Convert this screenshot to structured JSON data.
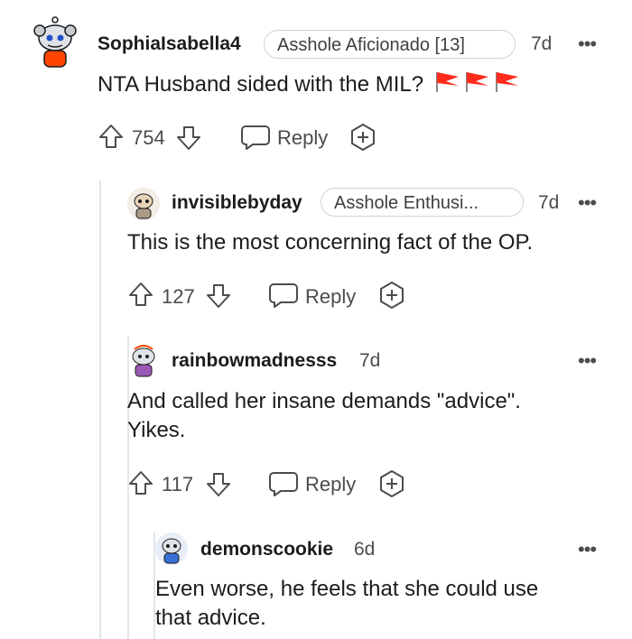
{
  "comments": [
    {
      "username": "SophiaIsabella4",
      "flair": "Asshole Aficionado [13]",
      "time": "7d",
      "body": "NTA Husband sided with the MIL?",
      "flag_emoji": "🚩🚩🚩",
      "votes": "754",
      "reply_label": "Reply",
      "more_label": "•••"
    },
    {
      "username": "invisiblebyday",
      "flair": "Asshole Enthusi...",
      "time": "7d",
      "body": "This is the most concerning fact of the OP.",
      "votes": "127",
      "reply_label": "Reply",
      "more_label": "•••"
    },
    {
      "username": "rainbowmadnesss",
      "time": "7d",
      "body_line1": "And called her insane demands \"advice\".",
      "body_line2": "Yikes.",
      "votes": "117",
      "reply_label": "Reply",
      "more_label": "•••"
    },
    {
      "username": "demonscookie",
      "time": "6d",
      "body_line1": "Even worse, he feels that she could use",
      "body_line2": "that advice.",
      "more_label": "•••"
    }
  ],
  "colors": {
    "text": "#1c1c1c",
    "muted": "#4a4c4e",
    "thread_line": "#e3e5e8",
    "flag": "#ff4500"
  }
}
